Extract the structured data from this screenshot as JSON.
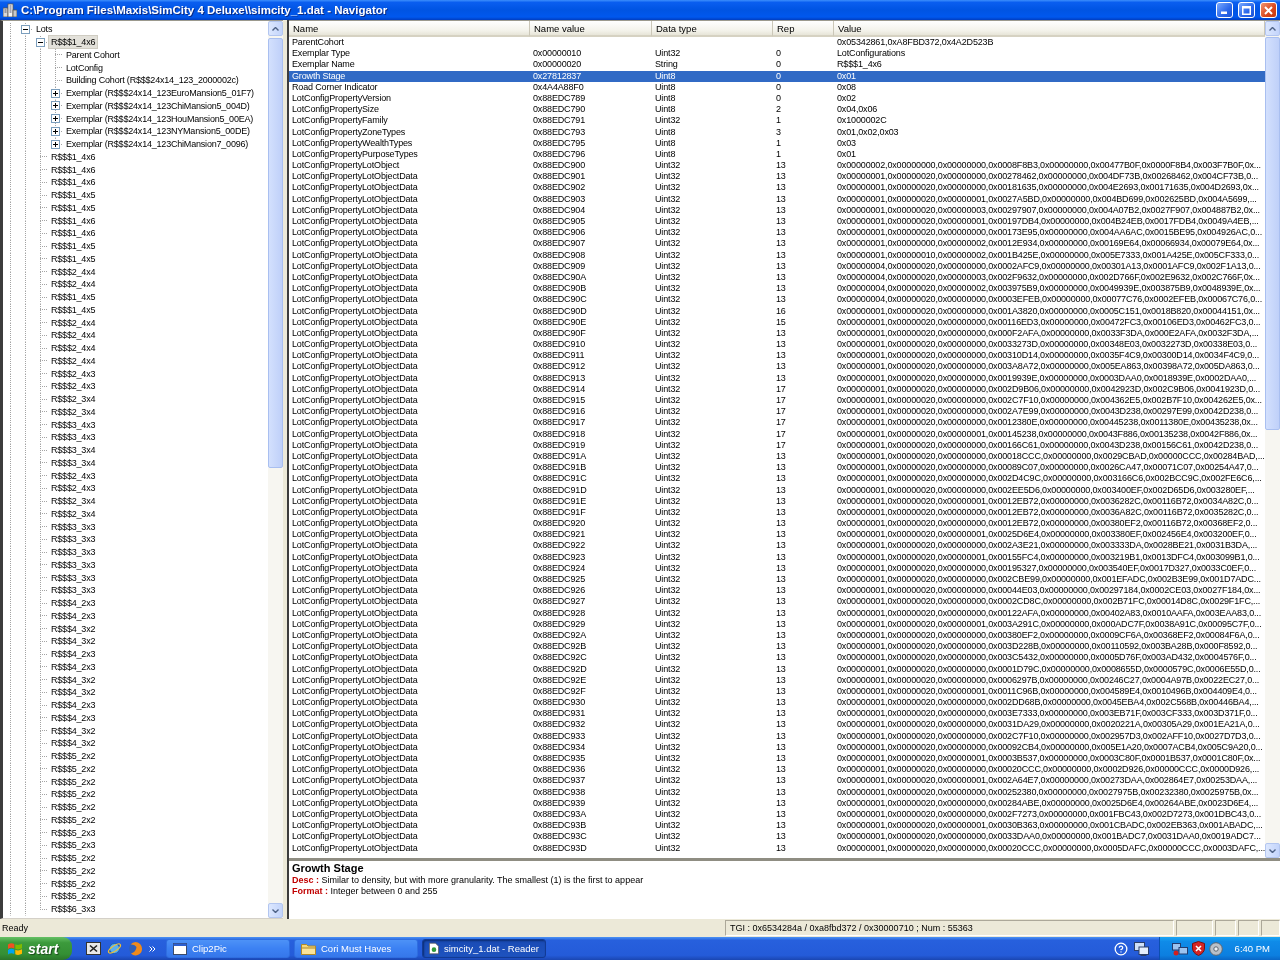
{
  "window": {
    "title": "C:\\Program Files\\Maxis\\SimCity 4 Deluxe\\\\simcity_1.dat - Navigator"
  },
  "tree": {
    "nodes": [
      {
        "label": "Lots",
        "expanded": true,
        "selected": false,
        "children": [
          {
            "label": "R$$$1_4x6",
            "expanded": true,
            "selected": true,
            "children": [
              {
                "label": "Parent Cohort",
                "selected": false
              },
              {
                "label": "LotConfig",
                "selected": false
              },
              {
                "label": "Building Cohort (R$$$24x14_123_2000002c)",
                "selected": false
              },
              {
                "label": "Exemplar (R$$$24x14_123EuroMansion5_01F7)",
                "expanded": false,
                "selected": false
              },
              {
                "label": "Exemplar (R$$$24x14_123ChiMansion5_004D)",
                "expanded": false,
                "selected": false
              },
              {
                "label": "Exemplar (R$$$24x14_123HouMansion5_00EA)",
                "expanded": false,
                "selected": false
              },
              {
                "label": "Exemplar (R$$$24x14_123NYMansion5_00DE)",
                "expanded": false,
                "selected": false
              },
              {
                "label": "Exemplar (R$$$24x14_123ChiMansion7_0096)",
                "expanded": false,
                "selected": false
              }
            ]
          },
          {
            "label": "R$$$1_4x6",
            "selected": false
          },
          {
            "label": "R$$$1_4x6",
            "selected": false
          },
          {
            "label": "R$$$1_4x6",
            "selected": false
          },
          {
            "label": "R$$$1_4x5",
            "selected": false
          },
          {
            "label": "R$$$1_4x5",
            "selected": false
          },
          {
            "label": "R$$$1_4x6",
            "selected": false
          },
          {
            "label": "R$$$1_4x6",
            "selected": false
          },
          {
            "label": "R$$$1_4x5",
            "selected": false
          },
          {
            "label": "R$$$1_4x5",
            "selected": false
          },
          {
            "label": "R$$$2_4x4",
            "selected": false
          },
          {
            "label": "R$$$2_4x4",
            "selected": false
          },
          {
            "label": "R$$$1_4x5",
            "selected": false
          },
          {
            "label": "R$$$1_4x5",
            "selected": false
          },
          {
            "label": "R$$$2_4x4",
            "selected": false
          },
          {
            "label": "R$$$2_4x4",
            "selected": false
          },
          {
            "label": "R$$$2_4x4",
            "selected": false
          },
          {
            "label": "R$$$2_4x4",
            "selected": false
          },
          {
            "label": "R$$$2_4x3",
            "selected": false
          },
          {
            "label": "R$$$2_4x3",
            "selected": false
          },
          {
            "label": "R$$$2_3x4",
            "selected": false
          },
          {
            "label": "R$$$2_3x4",
            "selected": false
          },
          {
            "label": "R$$$3_4x3",
            "selected": false
          },
          {
            "label": "R$$$3_4x3",
            "selected": false
          },
          {
            "label": "R$$$3_3x4",
            "selected": false
          },
          {
            "label": "R$$$3_3x4",
            "selected": false
          },
          {
            "label": "R$$$2_4x3",
            "selected": false
          },
          {
            "label": "R$$$2_4x3",
            "selected": false
          },
          {
            "label": "R$$$2_3x4",
            "selected": false
          },
          {
            "label": "R$$$2_3x4",
            "selected": false
          },
          {
            "label": "R$$$3_3x3",
            "selected": false
          },
          {
            "label": "R$$$3_3x3",
            "selected": false
          },
          {
            "label": "R$$$3_3x3",
            "selected": false
          },
          {
            "label": "R$$$3_3x3",
            "selected": false
          },
          {
            "label": "R$$$3_3x3",
            "selected": false
          },
          {
            "label": "R$$$3_3x3",
            "selected": false
          },
          {
            "label": "R$$$4_2x3",
            "selected": false
          },
          {
            "label": "R$$$4_2x3",
            "selected": false
          },
          {
            "label": "R$$$4_3x2",
            "selected": false
          },
          {
            "label": "R$$$4_3x2",
            "selected": false
          },
          {
            "label": "R$$$4_2x3",
            "selected": false
          },
          {
            "label": "R$$$4_2x3",
            "selected": false
          },
          {
            "label": "R$$$4_3x2",
            "selected": false
          },
          {
            "label": "R$$$4_3x2",
            "selected": false
          },
          {
            "label": "R$$$4_2x3",
            "selected": false
          },
          {
            "label": "R$$$4_2x3",
            "selected": false
          },
          {
            "label": "R$$$4_3x2",
            "selected": false
          },
          {
            "label": "R$$$4_3x2",
            "selected": false
          },
          {
            "label": "R$$$5_2x2",
            "selected": false
          },
          {
            "label": "R$$$5_2x2",
            "selected": false
          },
          {
            "label": "R$$$5_2x2",
            "selected": false
          },
          {
            "label": "R$$$5_2x2",
            "selected": false
          },
          {
            "label": "R$$$5_2x2",
            "selected": false
          },
          {
            "label": "R$$$5_2x2",
            "selected": false
          },
          {
            "label": "R$$$5_2x3",
            "selected": false
          },
          {
            "label": "R$$$5_2x3",
            "selected": false
          },
          {
            "label": "R$$$5_2x2",
            "selected": false
          },
          {
            "label": "R$$$5_2x2",
            "selected": false
          },
          {
            "label": "R$$$5_2x2",
            "selected": false
          },
          {
            "label": "R$$$5_2x2",
            "selected": false
          },
          {
            "label": "R$$$6_3x3",
            "selected": false
          }
        ]
      }
    ]
  },
  "table": {
    "columns": [
      "Name",
      "Name value",
      "Data type",
      "Rep",
      "Value"
    ],
    "rows": [
      {
        "name": "ParentCohort",
        "value": "0x05342861,0xA8FBD372,0x4A2D523B",
        "selected": false
      },
      {
        "name": "Exemplar Type",
        "name_value": "0x00000010",
        "data_type": "Uint32",
        "rep": "0",
        "value": "LotConfigurations",
        "selected": false
      },
      {
        "name": "Exemplar Name",
        "name_value": "0x00000020",
        "data_type": "String",
        "rep": "0",
        "value": "R$$$1_4x6",
        "selected": false
      },
      {
        "name": "Growth Stage",
        "name_value": "0x27812837",
        "data_type": "Uint8",
        "rep": "0",
        "value": "0x01",
        "selected": true
      },
      {
        "name": "Road Corner Indicator",
        "name_value": "0x4A4A88F0",
        "data_type": "Uint8",
        "rep": "0",
        "value": "0x08",
        "selected": false
      },
      {
        "name": "LotConfigPropertyVersion",
        "name_value": "0x88EDC789",
        "data_type": "Uint8",
        "rep": "0",
        "value": "0x02",
        "selected": false
      },
      {
        "name": "LotConfigPropertySize",
        "name_value": "0x88EDC790",
        "data_type": "Uint8",
        "rep": "2",
        "value": "0x04,0x06",
        "selected": false
      },
      {
        "name": "LotConfigPropertyFamily",
        "name_value": "0x88EDC791",
        "data_type": "Uint32",
        "rep": "1",
        "value": "0x1000002C",
        "selected": false
      },
      {
        "name": "LotConfigPropertyZoneTypes",
        "name_value": "0x88EDC793",
        "data_type": "Uint8",
        "rep": "3",
        "value": "0x01,0x02,0x03",
        "selected": false
      },
      {
        "name": "LotConfigPropertyWealthTypes",
        "name_value": "0x88EDC795",
        "data_type": "Uint8",
        "rep": "1",
        "value": "0x03",
        "selected": false
      },
      {
        "name": "LotConfigPropertyPurposeTypes",
        "name_value": "0x88EDC796",
        "data_type": "Uint8",
        "rep": "1",
        "value": "0x01",
        "selected": false
      },
      {
        "name": "LotConfigPropertyLotObject",
        "name_value": "0x88EDC900",
        "data_type": "Uint32",
        "rep": "13",
        "value": "0x00000002,0x00000000,0x00000000,0x0008F8B3,0x00000000,0x00477B0F,0x0000F8B4,0x003F7B0F,0x...",
        "selected": false
      },
      {
        "name": "LotConfigPropertyLotObjectData",
        "name_value": "0x88EDC901",
        "data_type": "Uint32",
        "rep": "13",
        "value": "0x00000001,0x00000020,0x00000000,0x00278462,0x00000000,0x004DF73B,0x00268462,0x004CF73B,0...",
        "selected": false
      },
      {
        "name": "LotConfigPropertyLotObjectData",
        "name_value": "0x88EDC902",
        "data_type": "Uint32",
        "rep": "13",
        "value": "0x00000001,0x00000020,0x00000000,0x00181635,0x00000000,0x004E2693,0x00171635,0x004D2693,0x...",
        "selected": false
      },
      {
        "name": "LotConfigPropertyLotObjectData",
        "name_value": "0x88EDC903",
        "data_type": "Uint32",
        "rep": "13",
        "value": "0x00000001,0x00000020,0x00000001,0x0027A5BD,0x00000000,0x004BD699,0x002625BD,0x004A5699,...",
        "selected": false
      },
      {
        "name": "LotConfigPropertyLotObjectData",
        "name_value": "0x88EDC904",
        "data_type": "Uint32",
        "rep": "13",
        "value": "0x00000001,0x00000020,0x00000003,0x00297907,0x00000000,0x004A07B2,0x0027F907,0x004887B2,0x...",
        "selected": false
      },
      {
        "name": "LotConfigPropertyLotObjectData",
        "name_value": "0x88EDC905",
        "data_type": "Uint32",
        "rep": "13",
        "value": "0x00000001,0x00000020,0x00000001,0x00197DB4,0x00000000,0x004B24EB,0x0017FDB4,0x0049A4EB,...",
        "selected": false
      },
      {
        "name": "LotConfigPropertyLotObjectData",
        "name_value": "0x88EDC906",
        "data_type": "Uint32",
        "rep": "13",
        "value": "0x00000001,0x00000020,0x00000000,0x00173E95,0x00000000,0x004AA6AC,0x0015BE95,0x004926AC,0...",
        "selected": false
      },
      {
        "name": "LotConfigPropertyLotObjectData",
        "name_value": "0x88EDC907",
        "data_type": "Uint32",
        "rep": "13",
        "value": "0x00000001,0x00000000,0x00000002,0x0012E934,0x00000000,0x00169E64,0x00066934,0x00079E64,0x...",
        "selected": false
      },
      {
        "name": "LotConfigPropertyLotObjectData",
        "name_value": "0x88EDC908",
        "data_type": "Uint32",
        "rep": "13",
        "value": "0x00000001,0x00000010,0x00000002,0x001B425E,0x00000000,0x005E7333,0x001A425E,0x005CF333,0...",
        "selected": false
      },
      {
        "name": "LotConfigPropertyLotObjectData",
        "name_value": "0x88EDC909",
        "data_type": "Uint32",
        "rep": "13",
        "value": "0x00000004,0x00000020,0x00000000,0x0002AFC9,0x00000000,0x00301A13,0x0001AFC9,0x002F1A13,0...",
        "selected": false
      },
      {
        "name": "LotConfigPropertyLotObjectData",
        "name_value": "0x88EDC90A",
        "data_type": "Uint32",
        "rep": "13",
        "value": "0x00000004,0x00000020,0x00000003,0x002F9632,0x00000000,0x002D766F,0x002E9632,0x002C766F,0x...",
        "selected": false
      },
      {
        "name": "LotConfigPropertyLotObjectData",
        "name_value": "0x88EDC90B",
        "data_type": "Uint32",
        "rep": "13",
        "value": "0x00000004,0x00000020,0x00000002,0x003975B9,0x00000000,0x0049939E,0x003875B9,0x0048939E,0x...",
        "selected": false
      },
      {
        "name": "LotConfigPropertyLotObjectData",
        "name_value": "0x88EDC90C",
        "data_type": "Uint32",
        "rep": "13",
        "value": "0x00000004,0x00000020,0x00000000,0x0003EFEB,0x00000000,0x00077C76,0x0002EFEB,0x00067C76,0...",
        "selected": false
      },
      {
        "name": "LotConfigPropertyLotObjectData",
        "name_value": "0x88EDC90D",
        "data_type": "Uint32",
        "rep": "16",
        "value": "0x00000001,0x00000020,0x00000000,0x001A3820,0x00000000,0x0005C151,0x0018B820,0x00044151,0x...",
        "selected": false
      },
      {
        "name": "LotConfigPropertyLotObjectData",
        "name_value": "0x88EDC90E",
        "data_type": "Uint32",
        "rep": "15",
        "value": "0x00000001,0x00000020,0x00000000,0x00116ED3,0x00000000,0x00472FC3,0x00106ED3,0x00462FC3,0...",
        "selected": false
      },
      {
        "name": "LotConfigPropertyLotObjectData",
        "name_value": "0x88EDC90F",
        "data_type": "Uint32",
        "rep": "13",
        "value": "0x00000001,0x00000020,0x00000000,0x000F2AFA,0x00000000,0x0033F3DA,0x000E2AFA,0x0032F3DA,...",
        "selected": false
      },
      {
        "name": "LotConfigPropertyLotObjectData",
        "name_value": "0x88EDC910",
        "data_type": "Uint32",
        "rep": "13",
        "value": "0x00000001,0x00000020,0x00000000,0x0033273D,0x00000000,0x00348E03,0x0032273D,0x00338E03,0...",
        "selected": false
      },
      {
        "name": "LotConfigPropertyLotObjectData",
        "name_value": "0x88EDC911",
        "data_type": "Uint32",
        "rep": "13",
        "value": "0x00000001,0x00000020,0x00000000,0x00310D14,0x00000000,0x0035F4C9,0x00300D14,0x0034F4C9,0...",
        "selected": false
      },
      {
        "name": "LotConfigPropertyLotObjectData",
        "name_value": "0x88EDC912",
        "data_type": "Uint32",
        "rep": "13",
        "value": "0x00000001,0x00000020,0x00000000,0x003A8A72,0x00000000,0x005EA863,0x00398A72,0x005DA863,0...",
        "selected": false
      },
      {
        "name": "LotConfigPropertyLotObjectData",
        "name_value": "0x88EDC913",
        "data_type": "Uint32",
        "rep": "13",
        "value": "0x00000001,0x00000020,0x00000000,0x0019939E,0x00000000,0x0003DAA0,0x0018939E,0x0002DAA0,...",
        "selected": false
      },
      {
        "name": "LotConfigPropertyLotObjectData",
        "name_value": "0x88EDC914",
        "data_type": "Uint32",
        "rep": "17",
        "value": "0x00000001,0x00000020,0x00000000,0x002D9B06,0x00000000,0x0042923D,0x002C9B06,0x0041923D,0...",
        "selected": false
      },
      {
        "name": "LotConfigPropertyLotObjectData",
        "name_value": "0x88EDC915",
        "data_type": "Uint32",
        "rep": "17",
        "value": "0x00000001,0x00000020,0x00000000,0x002C7F10,0x00000000,0x004362E5,0x002B7F10,0x004262E5,0x...",
        "selected": false
      },
      {
        "name": "LotConfigPropertyLotObjectData",
        "name_value": "0x88EDC916",
        "data_type": "Uint32",
        "rep": "17",
        "value": "0x00000001,0x00000020,0x00000000,0x002A7E99,0x00000000,0x0043D238,0x00297E99,0x0042D238,0...",
        "selected": false
      },
      {
        "name": "LotConfigPropertyLotObjectData",
        "name_value": "0x88EDC917",
        "data_type": "Uint32",
        "rep": "17",
        "value": "0x00000001,0x00000020,0x00000000,0x0012380E,0x00000000,0x00445238,0x0011380E,0x00435238,0x...",
        "selected": false
      },
      {
        "name": "LotConfigPropertyLotObjectData",
        "name_value": "0x88EDC918",
        "data_type": "Uint32",
        "rep": "17",
        "value": "0x00000001,0x00000020,0x00000001,0x00145238,0x00000000,0x0043F886,0x00135238,0x0042F886,0x...",
        "selected": false
      },
      {
        "name": "LotConfigPropertyLotObjectData",
        "name_value": "0x88EDC919",
        "data_type": "Uint32",
        "rep": "17",
        "value": "0x00000001,0x00000020,0x00000000,0x00166C61,0x00000000,0x0043D238,0x00156C61,0x0042D238,0...",
        "selected": false
      },
      {
        "name": "LotConfigPropertyLotObjectData",
        "name_value": "0x88EDC91A",
        "data_type": "Uint32",
        "rep": "13",
        "value": "0x00000001,0x00000020,0x00000000,0x00018CCC,0x00000000,0x0029CBAD,0x00000CCC,0x00284BAD,...",
        "selected": false
      },
      {
        "name": "LotConfigPropertyLotObjectData",
        "name_value": "0x88EDC91B",
        "data_type": "Uint32",
        "rep": "13",
        "value": "0x00000001,0x00000020,0x00000000,0x00089C07,0x00000000,0x0026CA47,0x00071C07,0x00254A47,0...",
        "selected": false
      },
      {
        "name": "LotConfigPropertyLotObjectData",
        "name_value": "0x88EDC91C",
        "data_type": "Uint32",
        "rep": "13",
        "value": "0x00000001,0x00000020,0x00000000,0x002D4C9C,0x00000000,0x003166C6,0x002BCC9C,0x002FE6C6,...",
        "selected": false
      },
      {
        "name": "LotConfigPropertyLotObjectData",
        "name_value": "0x88EDC91D",
        "data_type": "Uint32",
        "rep": "13",
        "value": "0x00000001,0x00000020,0x00000000,0x002EE5D6,0x00000000,0x003400EF,0x002D65D6,0x003280EF,...",
        "selected": false
      },
      {
        "name": "LotConfigPropertyLotObjectData",
        "name_value": "0x88EDC91E",
        "data_type": "Uint32",
        "rep": "13",
        "value": "0x00000001,0x00000020,0x00000001,0x0012EB72,0x00000000,0x0036282C,0x00116B72,0x0034A82C,0...",
        "selected": false
      },
      {
        "name": "LotConfigPropertyLotObjectData",
        "name_value": "0x88EDC91F",
        "data_type": "Uint32",
        "rep": "13",
        "value": "0x00000001,0x00000020,0x00000000,0x0012EB72,0x00000000,0x0036A82C,0x00116B72,0x0035282C,0...",
        "selected": false
      },
      {
        "name": "LotConfigPropertyLotObjectData",
        "name_value": "0x88EDC920",
        "data_type": "Uint32",
        "rep": "13",
        "value": "0x00000001,0x00000020,0x00000000,0x0012EB72,0x00000000,0x00380EF2,0x00116B72,0x00368EF2,0...",
        "selected": false
      },
      {
        "name": "LotConfigPropertyLotObjectData",
        "name_value": "0x88EDC921",
        "data_type": "Uint32",
        "rep": "13",
        "value": "0x00000001,0x00000020,0x00000001,0x0025D6E4,0x00000000,0x003380EF,0x002456E4,0x003200EF,0...",
        "selected": false
      },
      {
        "name": "LotConfigPropertyLotObjectData",
        "name_value": "0x88EDC922",
        "data_type": "Uint32",
        "rep": "13",
        "value": "0x00000001,0x00000020,0x00000000,0x002A3E21,0x00000000,0x003333DA,0x0028BE21,0x0031B3DA,...",
        "selected": false
      },
      {
        "name": "LotConfigPropertyLotObjectData",
        "name_value": "0x88EDC923",
        "data_type": "Uint32",
        "rep": "13",
        "value": "0x00000001,0x00000020,0x00000001,0x00155FC4,0x00000000,0x003219B1,0x0013DFC4,0x003099B1,0...",
        "selected": false
      },
      {
        "name": "LotConfigPropertyLotObjectData",
        "name_value": "0x88EDC924",
        "data_type": "Uint32",
        "rep": "13",
        "value": "0x00000001,0x00000020,0x00000000,0x00195327,0x00000000,0x003540EF,0x0017D327,0x0033C0EF,0...",
        "selected": false
      },
      {
        "name": "LotConfigPropertyLotObjectData",
        "name_value": "0x88EDC925",
        "data_type": "Uint32",
        "rep": "13",
        "value": "0x00000001,0x00000020,0x00000000,0x002CBE99,0x00000000,0x001EFADC,0x002B3E99,0x001D7ADC...",
        "selected": false
      },
      {
        "name": "LotConfigPropertyLotObjectData",
        "name_value": "0x88EDC926",
        "data_type": "Uint32",
        "rep": "13",
        "value": "0x00000001,0x00000020,0x00000000,0x00044E03,0x00000000,0x00297184,0x0002CE03,0x0027F184,0x...",
        "selected": false
      },
      {
        "name": "LotConfigPropertyLotObjectData",
        "name_value": "0x88EDC927",
        "data_type": "Uint32",
        "rep": "13",
        "value": "0x00000001,0x00000020,0x00000000,0x0002CD8C,0x00000000,0x002B71FC,0x00014D8C,0x0029F1FC,...",
        "selected": false
      },
      {
        "name": "LotConfigPropertyLotObjectData",
        "name_value": "0x88EDC928",
        "data_type": "Uint32",
        "rep": "13",
        "value": "0x00000001,0x00000020,0x00000000,0x00122AFA,0x00000000,0x00402A83,0x0010AAFA,0x003EAA83,0...",
        "selected": false
      },
      {
        "name": "LotConfigPropertyLotObjectData",
        "name_value": "0x88EDC929",
        "data_type": "Uint32",
        "rep": "13",
        "value": "0x00000001,0x00000020,0x00000001,0x003A291C,0x00000000,0x000ADC7F,0x0038A91C,0x00095C7F,0...",
        "selected": false
      },
      {
        "name": "LotConfigPropertyLotObjectData",
        "name_value": "0x88EDC92A",
        "data_type": "Uint32",
        "rep": "13",
        "value": "0x00000001,0x00000020,0x00000000,0x00380EF2,0x00000000,0x0009CF6A,0x00368EF2,0x00084F6A,0...",
        "selected": false
      },
      {
        "name": "LotConfigPropertyLotObjectData",
        "name_value": "0x88EDC92B",
        "data_type": "Uint32",
        "rep": "13",
        "value": "0x00000001,0x00000020,0x00000000,0x003D228B,0x00000000,0x00110592,0x003BA28B,0x000F8592,0...",
        "selected": false
      },
      {
        "name": "LotConfigPropertyLotObjectData",
        "name_value": "0x88EDC92C",
        "data_type": "Uint32",
        "rep": "13",
        "value": "0x00000001,0x00000020,0x00000000,0x003C5432,0x00000000,0x0005D76F,0x003AD432,0x0004576F,0...",
        "selected": false
      },
      {
        "name": "LotConfigPropertyLotObjectData",
        "name_value": "0x88EDC92D",
        "data_type": "Uint32",
        "rep": "13",
        "value": "0x00000001,0x00000020,0x00000000,0x0001D79C,0x00000000,0x0008655D,0x0000579C,0x0006E55D,0...",
        "selected": false
      },
      {
        "name": "LotConfigPropertyLotObjectData",
        "name_value": "0x88EDC92E",
        "data_type": "Uint32",
        "rep": "13",
        "value": "0x00000001,0x00000020,0x00000000,0x0006297B,0x00000000,0x00246C27,0x0004A97B,0x0022EC27,0...",
        "selected": false
      },
      {
        "name": "LotConfigPropertyLotObjectData",
        "name_value": "0x88EDC92F",
        "data_type": "Uint32",
        "rep": "13",
        "value": "0x00000001,0x00000020,0x00000001,0x0011C96B,0x00000000,0x004589E4,0x0010496B,0x004409E4,0...",
        "selected": false
      },
      {
        "name": "LotConfigPropertyLotObjectData",
        "name_value": "0x88EDC930",
        "data_type": "Uint32",
        "rep": "13",
        "value": "0x00000001,0x00000020,0x00000000,0x002DD68B,0x00000000,0x0045EBA4,0x002C568B,0x00446BA4,...",
        "selected": false
      },
      {
        "name": "LotConfigPropertyLotObjectData",
        "name_value": "0x88EDC931",
        "data_type": "Uint32",
        "rep": "13",
        "value": "0x00000001,0x00000020,0x00000000,0x003E7333,0x00000000,0x003EB71F,0x003CF333,0x003D371F,0...",
        "selected": false
      },
      {
        "name": "LotConfigPropertyLotObjectData",
        "name_value": "0x88EDC932",
        "data_type": "Uint32",
        "rep": "13",
        "value": "0x00000001,0x00000020,0x00000000,0x0031DA29,0x00000000,0x0020221A,0x00305A29,0x001EA21A,0...",
        "selected": false
      },
      {
        "name": "LotConfigPropertyLotObjectData",
        "name_value": "0x88EDC933",
        "data_type": "Uint32",
        "rep": "13",
        "value": "0x00000001,0x00000020,0x00000000,0x002C7F10,0x00000000,0x002957D3,0x002AFF10,0x0027D7D3,0...",
        "selected": false
      },
      {
        "name": "LotConfigPropertyLotObjectData",
        "name_value": "0x88EDC934",
        "data_type": "Uint32",
        "rep": "13",
        "value": "0x00000001,0x00000020,0x00000000,0x00092CB4,0x00000000,0x005E1A20,0x0007ACB4,0x005C9A20,0...",
        "selected": false
      },
      {
        "name": "LotConfigPropertyLotObjectData",
        "name_value": "0x88EDC935",
        "data_type": "Uint32",
        "rep": "13",
        "value": "0x00000001,0x00000020,0x00000001,0x0003B537,0x00000000,0x0003C80F,0x0001B537,0x0001C80F,0x...",
        "selected": false
      },
      {
        "name": "LotConfigPropertyLotObjectData",
        "name_value": "0x88EDC936",
        "data_type": "Uint32",
        "rep": "13",
        "value": "0x00000001,0x00000020,0x00000000,0x00020CCC,0x00000000,0x0002D926,0x00000CCC,0x0000D926,...",
        "selected": false
      },
      {
        "name": "LotConfigPropertyLotObjectData",
        "name_value": "0x88EDC937",
        "data_type": "Uint32",
        "rep": "13",
        "value": "0x00000001,0x00000020,0x00000001,0x002A64E7,0x00000000,0x00273DAA,0x002864E7,0x00253DAA,...",
        "selected": false
      },
      {
        "name": "LotConfigPropertyLotObjectData",
        "name_value": "0x88EDC938",
        "data_type": "Uint32",
        "rep": "13",
        "value": "0x00000001,0x00000020,0x00000000,0x00252380,0x00000000,0x0027975B,0x00232380,0x0025975B,0x...",
        "selected": false
      },
      {
        "name": "LotConfigPropertyLotObjectData",
        "name_value": "0x88EDC939",
        "data_type": "Uint32",
        "rep": "13",
        "value": "0x00000001,0x00000020,0x00000000,0x00284ABE,0x00000000,0x0025D6E4,0x00264ABE,0x0023D6E4,...",
        "selected": false
      },
      {
        "name": "LotConfigPropertyLotObjectData",
        "name_value": "0x88EDC93A",
        "data_type": "Uint32",
        "rep": "13",
        "value": "0x00000001,0x00000020,0x00000000,0x002F7273,0x00000000,0x001FBC43,0x002D7273,0x001DBC43,0...",
        "selected": false
      },
      {
        "name": "LotConfigPropertyLotObjectData",
        "name_value": "0x88EDC93B",
        "data_type": "Uint32",
        "rep": "13",
        "value": "0x00000001,0x00000020,0x00000001,0x0030B363,0x00000000,0x001CBADC,0x002EB363,0x001ABADC,...",
        "selected": false
      },
      {
        "name": "LotConfigPropertyLotObjectData",
        "name_value": "0x88EDC93C",
        "data_type": "Uint32",
        "rep": "13",
        "value": "0x00000001,0x00000020,0x00000000,0x0033DAA0,0x00000000,0x001BADC7,0x0031DAA0,0x0019ADC7...",
        "selected": false
      },
      {
        "name": "LotConfigPropertyLotObjectData",
        "name_value": "0x88EDC93D",
        "data_type": "Uint32",
        "rep": "13",
        "value": "0x00000001,0x00000020,0x00000000,0x00020CCC,0x00000000,0x0005DAFC,0x00000CCC,0x0003DAFC,...",
        "selected": false
      }
    ]
  },
  "details": {
    "title": "Growth Stage",
    "lines": [
      "**Desc :** Similar to density, but with more granularity. The smallest (1) is the first to appear",
      "**Format :** Integer between 0 and 255"
    ]
  },
  "status_bar": {
    "message": "Ready",
    "tgi": "TGI : 0x6534284a / 0xa8fbd372 / 0x30000710 ; Num : 55363"
  },
  "taskbar": {
    "start": "start",
    "tasks": [
      {
        "label": "Clip2Pic",
        "kind": "window",
        "selected": false
      },
      {
        "label": "Cori Must Haves",
        "kind": "folder",
        "selected": false
      },
      {
        "label": "simcity_1.dat - Reader",
        "kind": "document",
        "selected": true
      }
    ],
    "clock": "6:40 PM"
  }
}
